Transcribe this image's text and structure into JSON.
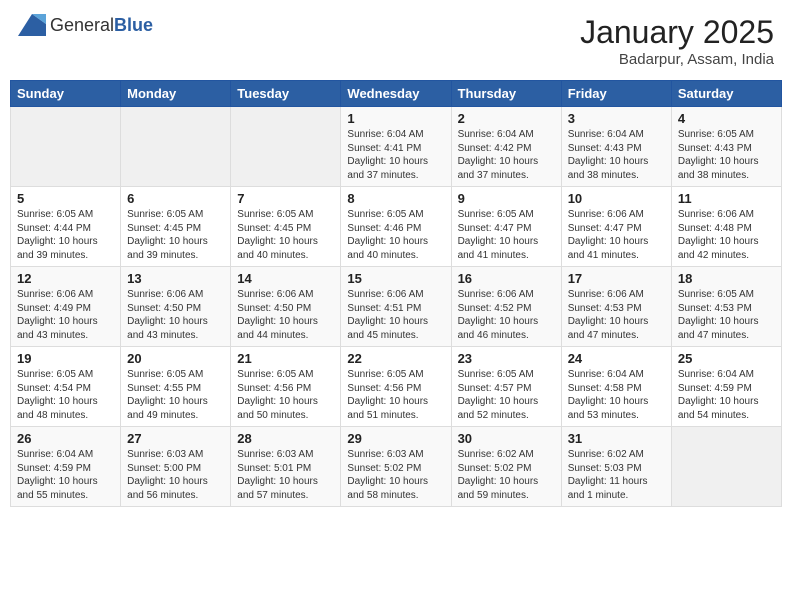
{
  "header": {
    "logo_general": "General",
    "logo_blue": "Blue",
    "month": "January 2025",
    "location": "Badarpur, Assam, India"
  },
  "days_of_week": [
    "Sunday",
    "Monday",
    "Tuesday",
    "Wednesday",
    "Thursday",
    "Friday",
    "Saturday"
  ],
  "weeks": [
    [
      {
        "day": "",
        "info": ""
      },
      {
        "day": "",
        "info": ""
      },
      {
        "day": "",
        "info": ""
      },
      {
        "day": "1",
        "info": "Sunrise: 6:04 AM\nSunset: 4:41 PM\nDaylight: 10 hours and 37 minutes."
      },
      {
        "day": "2",
        "info": "Sunrise: 6:04 AM\nSunset: 4:42 PM\nDaylight: 10 hours and 37 minutes."
      },
      {
        "day": "3",
        "info": "Sunrise: 6:04 AM\nSunset: 4:43 PM\nDaylight: 10 hours and 38 minutes."
      },
      {
        "day": "4",
        "info": "Sunrise: 6:05 AM\nSunset: 4:43 PM\nDaylight: 10 hours and 38 minutes."
      }
    ],
    [
      {
        "day": "5",
        "info": "Sunrise: 6:05 AM\nSunset: 4:44 PM\nDaylight: 10 hours and 39 minutes."
      },
      {
        "day": "6",
        "info": "Sunrise: 6:05 AM\nSunset: 4:45 PM\nDaylight: 10 hours and 39 minutes."
      },
      {
        "day": "7",
        "info": "Sunrise: 6:05 AM\nSunset: 4:45 PM\nDaylight: 10 hours and 40 minutes."
      },
      {
        "day": "8",
        "info": "Sunrise: 6:05 AM\nSunset: 4:46 PM\nDaylight: 10 hours and 40 minutes."
      },
      {
        "day": "9",
        "info": "Sunrise: 6:05 AM\nSunset: 4:47 PM\nDaylight: 10 hours and 41 minutes."
      },
      {
        "day": "10",
        "info": "Sunrise: 6:06 AM\nSunset: 4:47 PM\nDaylight: 10 hours and 41 minutes."
      },
      {
        "day": "11",
        "info": "Sunrise: 6:06 AM\nSunset: 4:48 PM\nDaylight: 10 hours and 42 minutes."
      }
    ],
    [
      {
        "day": "12",
        "info": "Sunrise: 6:06 AM\nSunset: 4:49 PM\nDaylight: 10 hours and 43 minutes."
      },
      {
        "day": "13",
        "info": "Sunrise: 6:06 AM\nSunset: 4:50 PM\nDaylight: 10 hours and 43 minutes."
      },
      {
        "day": "14",
        "info": "Sunrise: 6:06 AM\nSunset: 4:50 PM\nDaylight: 10 hours and 44 minutes."
      },
      {
        "day": "15",
        "info": "Sunrise: 6:06 AM\nSunset: 4:51 PM\nDaylight: 10 hours and 45 minutes."
      },
      {
        "day": "16",
        "info": "Sunrise: 6:06 AM\nSunset: 4:52 PM\nDaylight: 10 hours and 46 minutes."
      },
      {
        "day": "17",
        "info": "Sunrise: 6:06 AM\nSunset: 4:53 PM\nDaylight: 10 hours and 47 minutes."
      },
      {
        "day": "18",
        "info": "Sunrise: 6:05 AM\nSunset: 4:53 PM\nDaylight: 10 hours and 47 minutes."
      }
    ],
    [
      {
        "day": "19",
        "info": "Sunrise: 6:05 AM\nSunset: 4:54 PM\nDaylight: 10 hours and 48 minutes."
      },
      {
        "day": "20",
        "info": "Sunrise: 6:05 AM\nSunset: 4:55 PM\nDaylight: 10 hours and 49 minutes."
      },
      {
        "day": "21",
        "info": "Sunrise: 6:05 AM\nSunset: 4:56 PM\nDaylight: 10 hours and 50 minutes."
      },
      {
        "day": "22",
        "info": "Sunrise: 6:05 AM\nSunset: 4:56 PM\nDaylight: 10 hours and 51 minutes."
      },
      {
        "day": "23",
        "info": "Sunrise: 6:05 AM\nSunset: 4:57 PM\nDaylight: 10 hours and 52 minutes."
      },
      {
        "day": "24",
        "info": "Sunrise: 6:04 AM\nSunset: 4:58 PM\nDaylight: 10 hours and 53 minutes."
      },
      {
        "day": "25",
        "info": "Sunrise: 6:04 AM\nSunset: 4:59 PM\nDaylight: 10 hours and 54 minutes."
      }
    ],
    [
      {
        "day": "26",
        "info": "Sunrise: 6:04 AM\nSunset: 4:59 PM\nDaylight: 10 hours and 55 minutes."
      },
      {
        "day": "27",
        "info": "Sunrise: 6:03 AM\nSunset: 5:00 PM\nDaylight: 10 hours and 56 minutes."
      },
      {
        "day": "28",
        "info": "Sunrise: 6:03 AM\nSunset: 5:01 PM\nDaylight: 10 hours and 57 minutes."
      },
      {
        "day": "29",
        "info": "Sunrise: 6:03 AM\nSunset: 5:02 PM\nDaylight: 10 hours and 58 minutes."
      },
      {
        "day": "30",
        "info": "Sunrise: 6:02 AM\nSunset: 5:02 PM\nDaylight: 10 hours and 59 minutes."
      },
      {
        "day": "31",
        "info": "Sunrise: 6:02 AM\nSunset: 5:03 PM\nDaylight: 11 hours and 1 minute."
      },
      {
        "day": "",
        "info": ""
      }
    ]
  ]
}
